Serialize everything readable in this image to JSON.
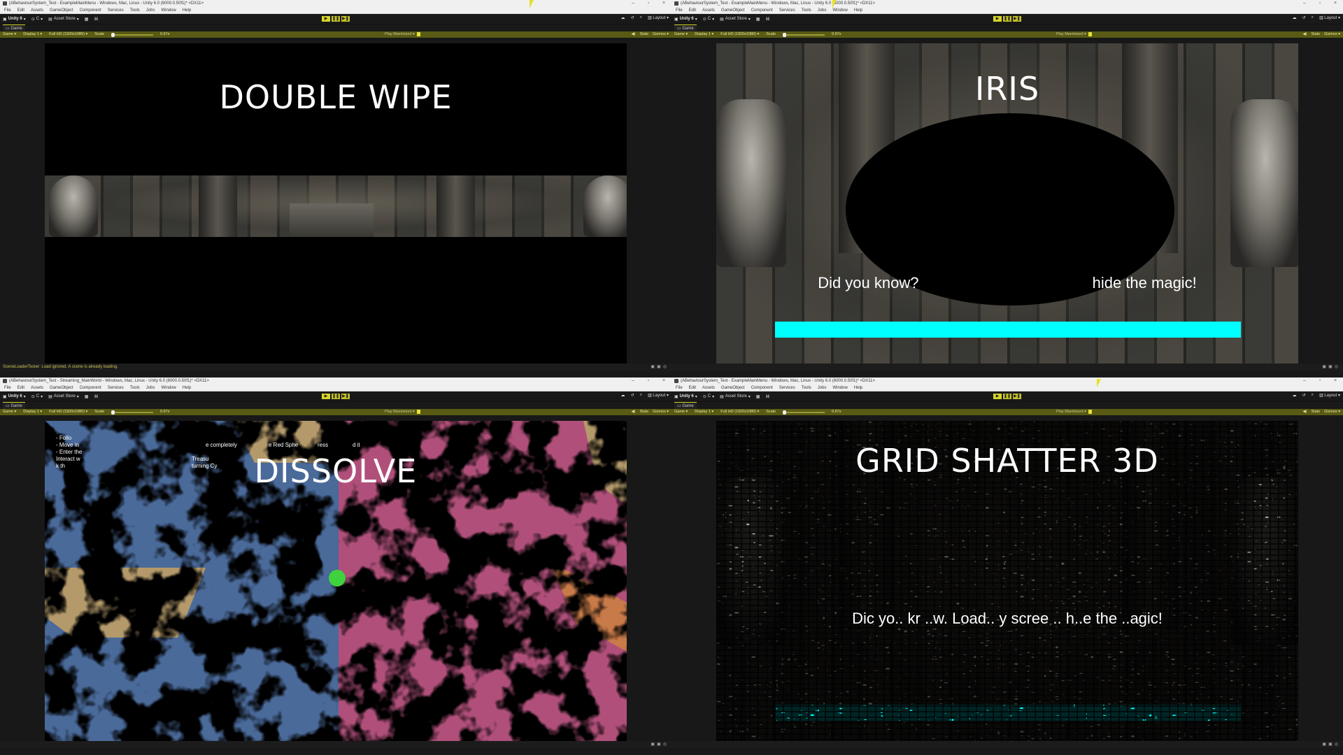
{
  "windows": [
    {
      "id": "tl",
      "title": "(ABehaviourSystem_Test - ExampleMainMenu - Windows, Mac, Linux - Unity 6.0 (6000.0.50f1)* <DX11>",
      "tab": "Game",
      "transition_title": "DOUBLE WIPE",
      "status": "SceneLoaderTester: Load ignored. A scene is already loading."
    },
    {
      "id": "tr",
      "title": "(ABehaviourSystem_Test - ExampleMainMenu - Windows, Mac, Linux - Unity 6.0 (6000.0.50f1)* <DX11>",
      "tab": "Game",
      "transition_title": "IRIS",
      "tip": "Did you know? Loading screens hide the magic!",
      "tip_visible": "Did you know?            hide the magic!",
      "progress": 1.0,
      "status": ""
    },
    {
      "id": "bl",
      "title": "(ABehaviourSystem_Test - Streaming_MainWorld - Windows, Mac, Linux - Unity 6.0 (6000.0.50f1)* <DX11>",
      "tab": "Game",
      "transition_title": "DISSOLVE",
      "help_lines": [
        "- Follo",
        "- Move in",
        "- Enter the",
        "Interact w",
        "k th"
      ],
      "help_fragments": [
        "e completely",
        "e Red Sphe",
        "ress",
        "d it",
        "Treasu",
        "turning Cy"
      ],
      "status": ""
    },
    {
      "id": "br",
      "title": "(ABehaviourSystem_Test - ExampleMainMenu - Windows, Mac, Linux - Unity 6.0 (6000.0.50f1)* <DX11>",
      "tab": "Game",
      "transition_title": "GRID SHATTER 3D",
      "tip": "Did you know? Loading screens hide the magic!",
      "tip_visible": "Dic yo.. kr ..w. Load.. y scree .. h..e the ..agic!",
      "status": ""
    }
  ],
  "menu": [
    "File",
    "Edit",
    "Assets",
    "GameObject",
    "Component",
    "Services",
    "Tools",
    "Jobs",
    "Window",
    "Help"
  ],
  "toolbar": {
    "account": "Unity 6",
    "cloud": "C",
    "asset_store": "Asset Store",
    "layout": "Layout"
  },
  "gamebar": {
    "view": "Game",
    "display": "Display 1",
    "resolution": "Full HD (1920x1080)",
    "scale_label": "Scale",
    "scale_value": "0.67x",
    "play_mode": "Play Maximized",
    "stats": "Stats",
    "gizmos": "Gizmos"
  },
  "colors": {
    "accent_yellow": "#d8d62a",
    "progress_cyan": "#00ffff",
    "gamebar_olive": "#595a14",
    "dissolve_blue": "#4a6a9a",
    "dissolve_pink": "#b0507a",
    "dissolve_tan": "#b49a6a",
    "dissolve_orange": "#c87a48"
  },
  "icons": [
    "window-minimize-icon",
    "window-maximize-icon",
    "window-close-icon",
    "play-icon",
    "pause-icon",
    "step-icon",
    "cloud-icon",
    "history-icon",
    "search-icon",
    "mute-icon",
    "settings-icon",
    "cursor-icon"
  ]
}
